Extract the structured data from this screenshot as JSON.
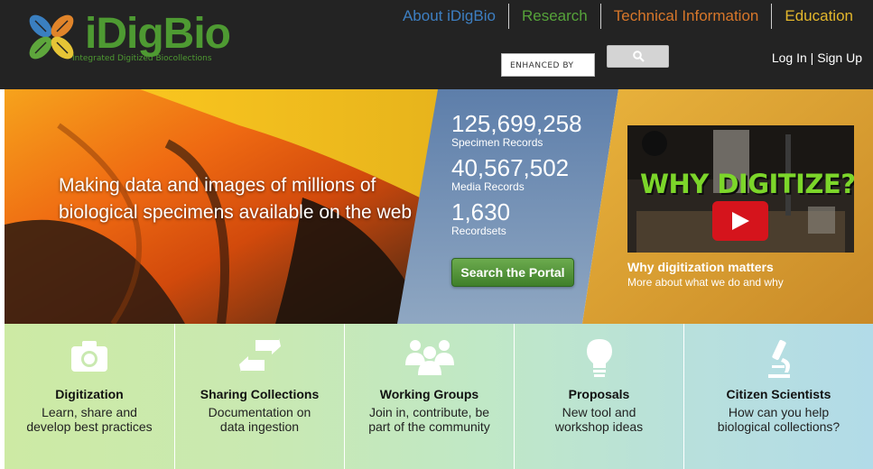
{
  "header": {
    "logo_text": "iDigBio",
    "logo_tagline": "Integrated Digitized Biocollections",
    "nav": [
      {
        "label": "About iDigBio",
        "color": "#3d7fc2"
      },
      {
        "label": "Research",
        "color": "#56a33a"
      },
      {
        "label": "Technical Information",
        "color": "#d8772a"
      },
      {
        "label": "Education",
        "color": "#e3b72c"
      }
    ],
    "search": {
      "label": "ENHANCED BY",
      "button_icon": "search-icon"
    },
    "auth": {
      "login": "Log In",
      "separator": "|",
      "signup": "Sign Up"
    }
  },
  "hero": {
    "tagline": "Making data and images of millions of biological specimens available on the web",
    "stats": [
      {
        "value": "125,699,258",
        "label": "Specimen Records"
      },
      {
        "value": "40,567,502",
        "label": "Media Records"
      },
      {
        "value": "1,630",
        "label": "Recordsets"
      }
    ],
    "portal_button": "Search the Portal",
    "video": {
      "title": "WHY DIGITIZE?",
      "play_icon": "play-icon",
      "caption_title": "Why digitization matters",
      "caption_sub": "More about what we do and why"
    }
  },
  "tiles": [
    {
      "icon": "camera-icon",
      "title": "Digitization",
      "desc": "Learn, share and develop best practices"
    },
    {
      "icon": "swap-arrows-icon",
      "title": "Sharing Collections",
      "desc": "Documentation on data ingestion"
    },
    {
      "icon": "group-people-icon",
      "title": "Working Groups",
      "desc": "Join in, contribute, be part of the community"
    },
    {
      "icon": "lightbulb-icon",
      "title": "Proposals",
      "desc": "New tool and workshop ideas"
    },
    {
      "icon": "microscope-icon",
      "title": "Citizen Scientists",
      "desc": "How can you help biological collections?"
    }
  ],
  "colors": {
    "header_bg": "#232323",
    "brand_green": "#4e9a32",
    "stats_panel": "#6d8fb8",
    "video_panel": "#d9a23b",
    "portal_button": "#4f8f38"
  }
}
